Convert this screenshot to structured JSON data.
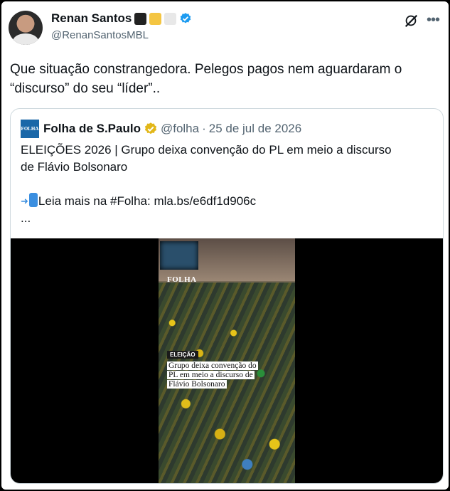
{
  "author": {
    "name": "Renan Santos",
    "handle": "@RenanSantosMBL",
    "emoji_colors": [
      "#222222",
      "#f4c542",
      "#e8e8e8"
    ]
  },
  "tweet": {
    "text_line1": "Que situação constrangedora. Pelegos pagos nem aguardaram o",
    "text_line2": "“discurso” do seu “líder”.."
  },
  "quoted": {
    "logo_text": "FOLHA",
    "name": "Folha de S.Paulo",
    "handle": "@folha",
    "separator": "·",
    "date": "25 de jul de 2026",
    "line1": "ELEIÇÕES 2026 | Grupo deixa convenção do PL em meio a discurso",
    "line2": "de Flávio Bolsonaro",
    "link_text": "Leia mais na #Folha: mla.bs/e6df1d906c",
    "ellipsis": "..."
  },
  "video": {
    "brand": "FOLHA",
    "tag": "ELEIÇÃO",
    "caption": "Grupo deixa convenção do PL em meio a discurso de Flávio Bolsonaro"
  },
  "icons": {
    "verified": "verified-badge-icon",
    "gold_verified": "gold-verified-badge-icon",
    "grok": "grok-icon",
    "more": "more-icon",
    "phone": "mobile-phone-arrow-icon"
  },
  "colors": {
    "verified_blue": "#1d9bf0",
    "gold": "#e2b719",
    "folha_blue": "#1a67a8"
  }
}
